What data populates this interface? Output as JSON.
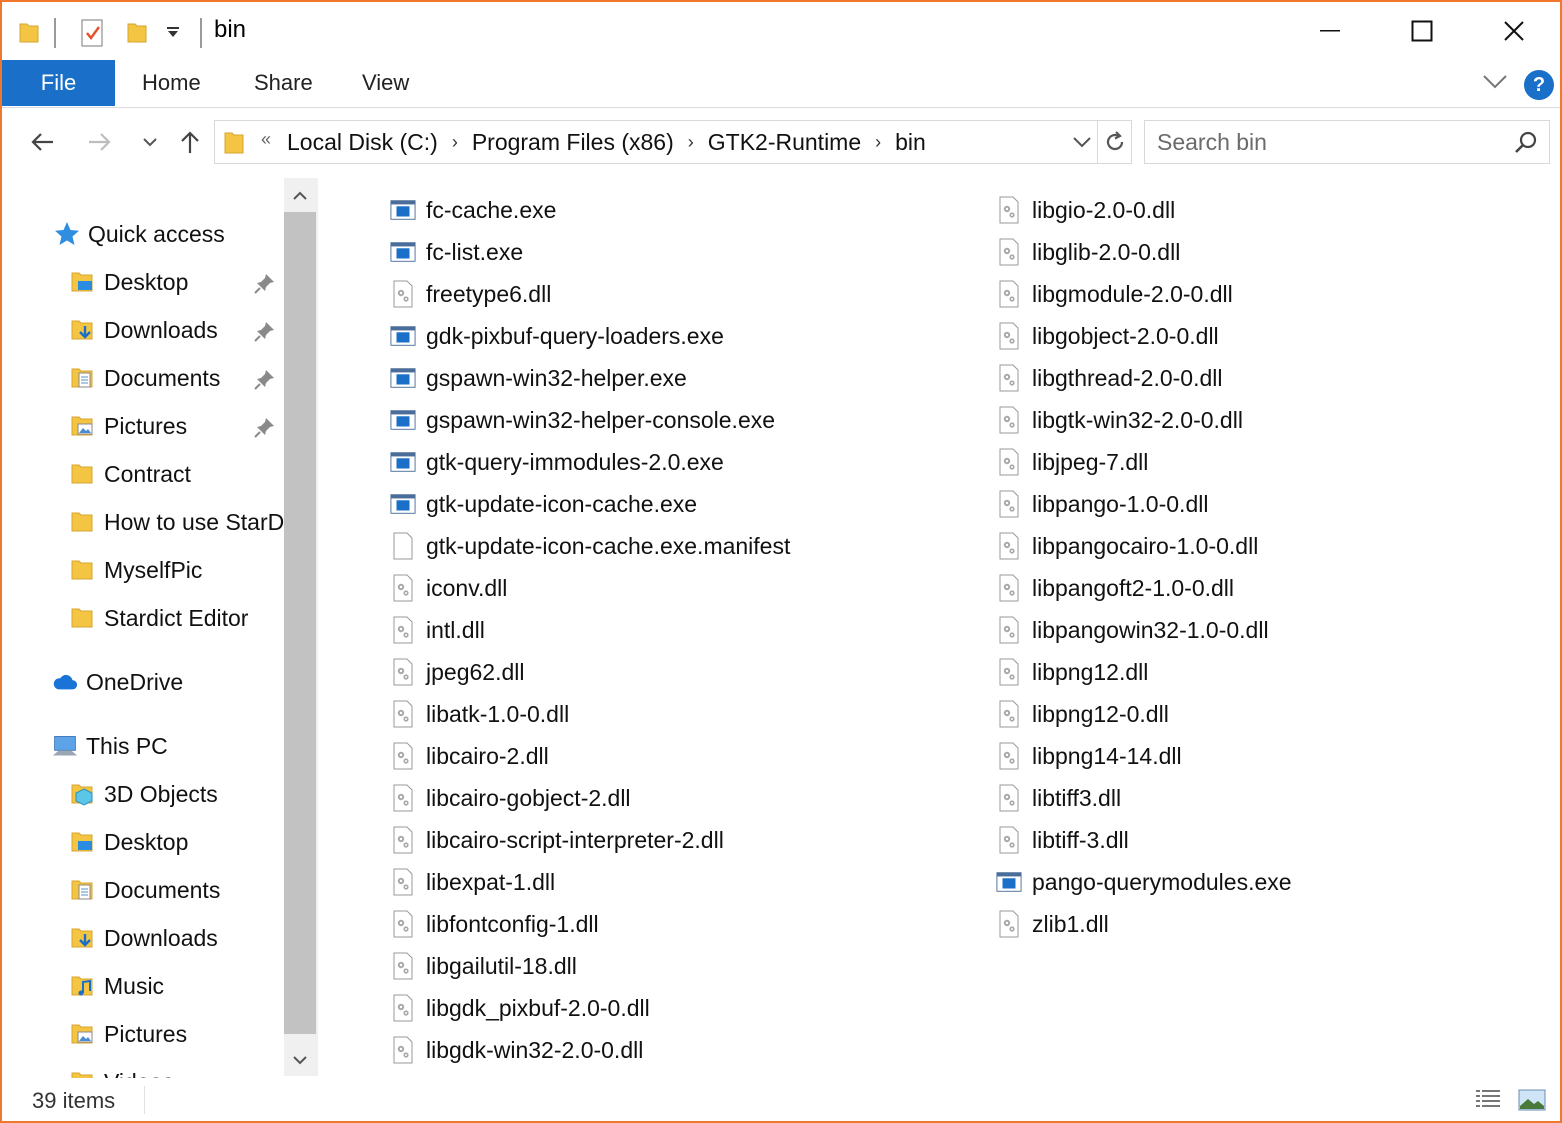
{
  "window": {
    "title": "bin",
    "controls": [
      "minimize",
      "maximize",
      "close"
    ]
  },
  "ribbon": {
    "tabs": [
      "File",
      "Home",
      "Share",
      "View"
    ],
    "help_label": "?"
  },
  "address_bar": {
    "overflow_glyph": "«",
    "crumbs": [
      "Local Disk (C:)",
      "Program Files (x86)",
      "GTK2-Runtime",
      "bin"
    ],
    "separator": "›"
  },
  "search": {
    "placeholder": "Search bin"
  },
  "sidebar": {
    "quick_access": "Quick access",
    "quick_items": [
      {
        "label": "Desktop",
        "icon": "desktop-folder-icon",
        "pinned": true
      },
      {
        "label": "Downloads",
        "icon": "downloads-folder-icon",
        "pinned": true
      },
      {
        "label": "Documents",
        "icon": "documents-folder-icon",
        "pinned": true
      },
      {
        "label": "Pictures",
        "icon": "pictures-folder-icon",
        "pinned": true
      },
      {
        "label": "Contract",
        "icon": "folder-icon",
        "pinned": false
      },
      {
        "label": "How to use StarD",
        "icon": "folder-icon",
        "pinned": false
      },
      {
        "label": "MyselfPic",
        "icon": "folder-icon",
        "pinned": false
      },
      {
        "label": "Stardict Editor",
        "icon": "folder-icon",
        "pinned": false
      }
    ],
    "onedrive": "OneDrive",
    "this_pc": "This PC",
    "pc_items": [
      {
        "label": "3D Objects",
        "icon": "3d-objects-icon"
      },
      {
        "label": "Desktop",
        "icon": "desktop-folder-icon"
      },
      {
        "label": "Documents",
        "icon": "documents-folder-icon"
      },
      {
        "label": "Downloads",
        "icon": "downloads-folder-icon"
      },
      {
        "label": "Music",
        "icon": "music-folder-icon"
      },
      {
        "label": "Pictures",
        "icon": "pictures-folder-icon"
      },
      {
        "label": "Videos",
        "icon": "videos-folder-icon"
      }
    ]
  },
  "files": {
    "column1": [
      {
        "name": "fc-cache.exe",
        "type": "exe"
      },
      {
        "name": "fc-list.exe",
        "type": "exe"
      },
      {
        "name": "freetype6.dll",
        "type": "dll"
      },
      {
        "name": "gdk-pixbuf-query-loaders.exe",
        "type": "exe"
      },
      {
        "name": "gspawn-win32-helper.exe",
        "type": "exe"
      },
      {
        "name": "gspawn-win32-helper-console.exe",
        "type": "exe"
      },
      {
        "name": "gtk-query-immodules-2.0.exe",
        "type": "exe"
      },
      {
        "name": "gtk-update-icon-cache.exe",
        "type": "exe"
      },
      {
        "name": "gtk-update-icon-cache.exe.manifest",
        "type": "file"
      },
      {
        "name": "iconv.dll",
        "type": "dll"
      },
      {
        "name": "intl.dll",
        "type": "dll"
      },
      {
        "name": "jpeg62.dll",
        "type": "dll"
      },
      {
        "name": "libatk-1.0-0.dll",
        "type": "dll"
      },
      {
        "name": "libcairo-2.dll",
        "type": "dll"
      },
      {
        "name": "libcairo-gobject-2.dll",
        "type": "dll"
      },
      {
        "name": "libcairo-script-interpreter-2.dll",
        "type": "dll"
      },
      {
        "name": "libexpat-1.dll",
        "type": "dll"
      },
      {
        "name": "libfontconfig-1.dll",
        "type": "dll"
      },
      {
        "name": "libgailutil-18.dll",
        "type": "dll"
      },
      {
        "name": "libgdk_pixbuf-2.0-0.dll",
        "type": "dll"
      },
      {
        "name": "libgdk-win32-2.0-0.dll",
        "type": "dll"
      }
    ],
    "column2": [
      {
        "name": "libgio-2.0-0.dll",
        "type": "dll"
      },
      {
        "name": "libglib-2.0-0.dll",
        "type": "dll"
      },
      {
        "name": "libgmodule-2.0-0.dll",
        "type": "dll"
      },
      {
        "name": "libgobject-2.0-0.dll",
        "type": "dll"
      },
      {
        "name": "libgthread-2.0-0.dll",
        "type": "dll"
      },
      {
        "name": "libgtk-win32-2.0-0.dll",
        "type": "dll"
      },
      {
        "name": "libjpeg-7.dll",
        "type": "dll"
      },
      {
        "name": "libpango-1.0-0.dll",
        "type": "dll"
      },
      {
        "name": "libpangocairo-1.0-0.dll",
        "type": "dll"
      },
      {
        "name": "libpangoft2-1.0-0.dll",
        "type": "dll"
      },
      {
        "name": "libpangowin32-1.0-0.dll",
        "type": "dll"
      },
      {
        "name": "libpng12.dll",
        "type": "dll"
      },
      {
        "name": "libpng12-0.dll",
        "type": "dll"
      },
      {
        "name": "libpng14-14.dll",
        "type": "dll"
      },
      {
        "name": "libtiff3.dll",
        "type": "dll"
      },
      {
        "name": "libtiff-3.dll",
        "type": "dll"
      },
      {
        "name": "pango-querymodules.exe",
        "type": "exe"
      },
      {
        "name": "zlib1.dll",
        "type": "dll"
      }
    ]
  },
  "status": {
    "item_count": "39 items"
  },
  "colors": {
    "accent": "#1a6fc9",
    "window_border": "#f0772c",
    "folder": "#f4c542"
  }
}
